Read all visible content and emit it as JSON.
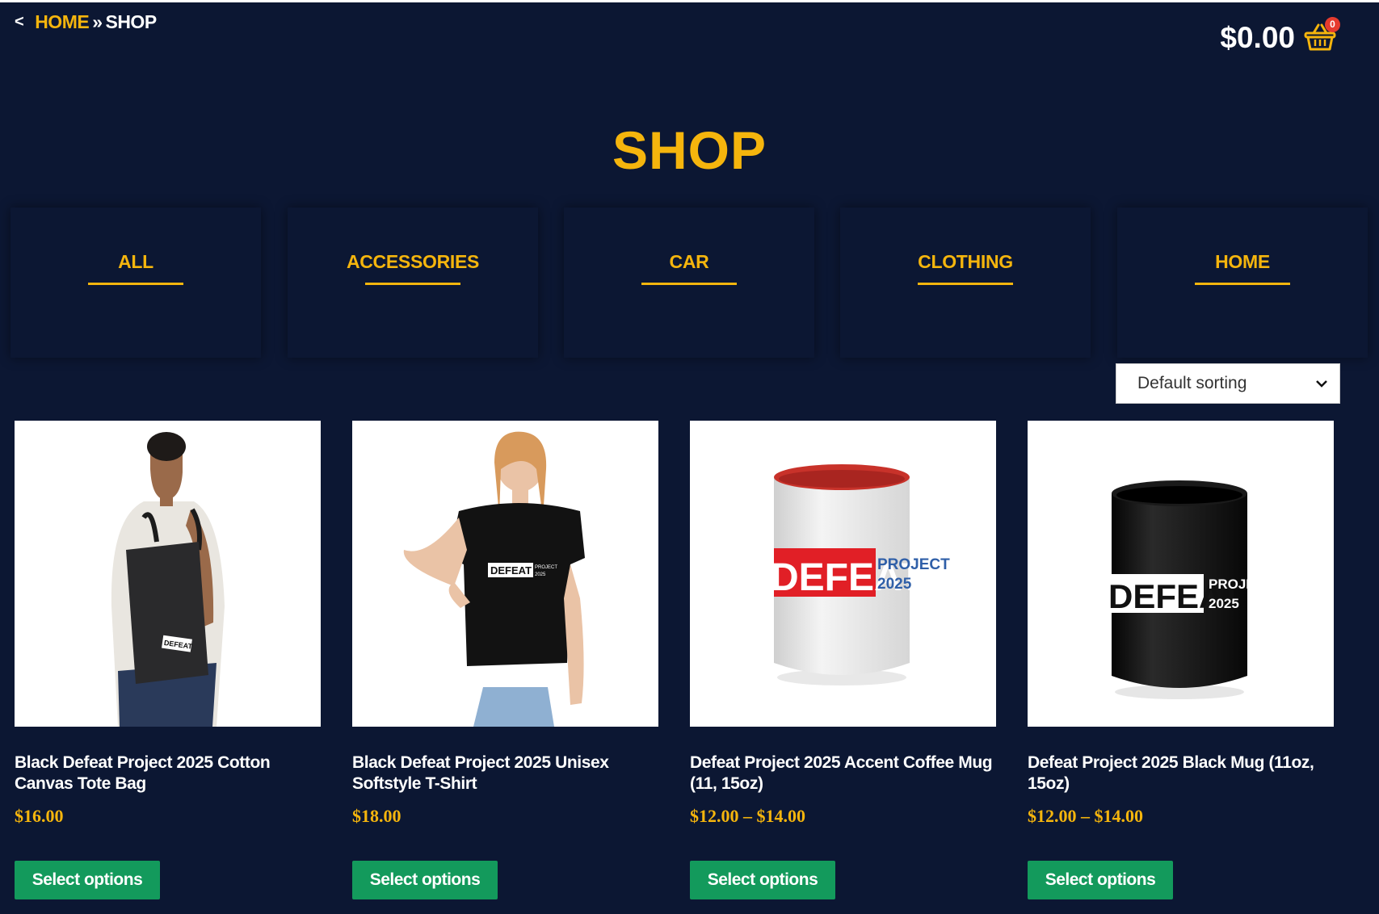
{
  "breadcrumb": {
    "back": "<",
    "home": "HOME",
    "separator": "»",
    "current": "SHOP"
  },
  "cart": {
    "total": "$0.00",
    "count": "0",
    "icon": "basket-icon"
  },
  "page_title": "SHOP",
  "categories": [
    {
      "label": "ALL"
    },
    {
      "label": "ACCESSORIES"
    },
    {
      "label": "CAR"
    },
    {
      "label": "CLOTHING"
    },
    {
      "label": "HOME"
    }
  ],
  "sorting": {
    "selected": "Default sorting",
    "icon": "chevron-down-icon"
  },
  "products": [
    {
      "name": "Black Defeat Project 2025 Cotton Canvas Tote Bag",
      "price": "$16.00",
      "button": "Select options"
    },
    {
      "name": "Black Defeat Project 2025 Unisex Softstyle T-Shirt",
      "price": "$18.00",
      "button": "Select options"
    },
    {
      "name": "Defeat Project 2025 Accent Coffee Mug (11, 15oz)",
      "price": "$12.00 – $14.00",
      "button": "Select options"
    },
    {
      "name": "Defeat Project 2025 Black Mug (11oz, 15oz)",
      "price": "$12.00 – $14.00",
      "button": "Select options"
    }
  ],
  "product_image_text": {
    "tote": "DEFEAT",
    "shirt_main": "DEFEAT",
    "shirt_small": "PROJECT",
    "shirt_year": "2025",
    "mug_word": "DEFEAT",
    "mug_project": "PROJECT",
    "mug_year": "2025"
  },
  "colors": {
    "background": "#0c1733",
    "accent": "#f5b50d",
    "button": "#139a5c",
    "badge": "#e63b2e"
  }
}
